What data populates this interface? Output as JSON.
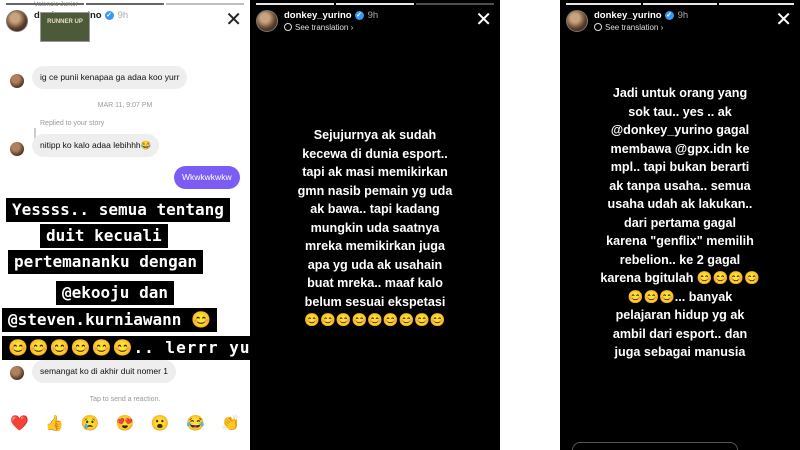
{
  "story1": {
    "username": "donkey_yurino",
    "time": "9h",
    "replied_top_label": "Valencio Junior",
    "thumb_text": "RUNNER UP",
    "messages": [
      {
        "text": "ig ce punii kenapaa ga adaa koo yurr"
      },
      {
        "text": "nitipp ko kalo adaa lebihhh😂"
      },
      {
        "text": "Wkwkwkwkw"
      },
      {
        "text": "semangat ko di akhir duit nomer 1"
      }
    ],
    "timestamp": "MAR 11, 9:07 PM",
    "replied_label": "Replied to your story",
    "highlight_lines": [
      "Yessss.. semua tentang",
      "duit kecuali",
      "pertemananku dengan",
      "@ekooju  dan",
      "@steven.kurniawann 😊",
      "😊😊😊😊😊😊.. lerrr yukk"
    ],
    "reaction_hint": "Tap to send a reaction.",
    "reactions": [
      "❤️",
      "👍",
      "😢",
      "😍",
      "😮",
      "😂",
      "👏"
    ]
  },
  "story2": {
    "username": "donkey_yurino",
    "time": "9h",
    "see_translation": "See translation",
    "lines": [
      "Sejujurnya ak sudah",
      "kecewa di dunia esport..",
      "tapi ak masi memikirkan",
      "gmn nasib pemain yg uda",
      "ak bawa.. tapi kadang",
      "mungkin uda saatnya",
      "mreka memikirkan juga",
      "apa yg uda ak usahain",
      "buat mreka.. maaf kalo",
      "belum sesuai ekspetasi",
      "😊😊😊😊😊😊😊😊😊"
    ]
  },
  "story3": {
    "username": "donkey_yurino",
    "time": "9h",
    "see_translation": "See translation",
    "lines": [
      "Jadi untuk orang yang",
      "sok tau.. yes .. ak",
      "@donkey_yurino gagal",
      "membawa @gpx.idn ke",
      "mpl.. tapi bukan berarti",
      "ak tanpa usaha.. semua",
      "usaha udah ak lakukan..",
      "dari pertama gagal",
      "karena \"genflix\" memilih",
      "rebelion.. ke 2 gagal",
      "karena bgitulah 😊😊😊😊",
      "😊😊😊... banyak",
      "pelajaran hidup yg ak",
      "ambil dari esport.. dan",
      "juga sebagai manusia"
    ]
  }
}
